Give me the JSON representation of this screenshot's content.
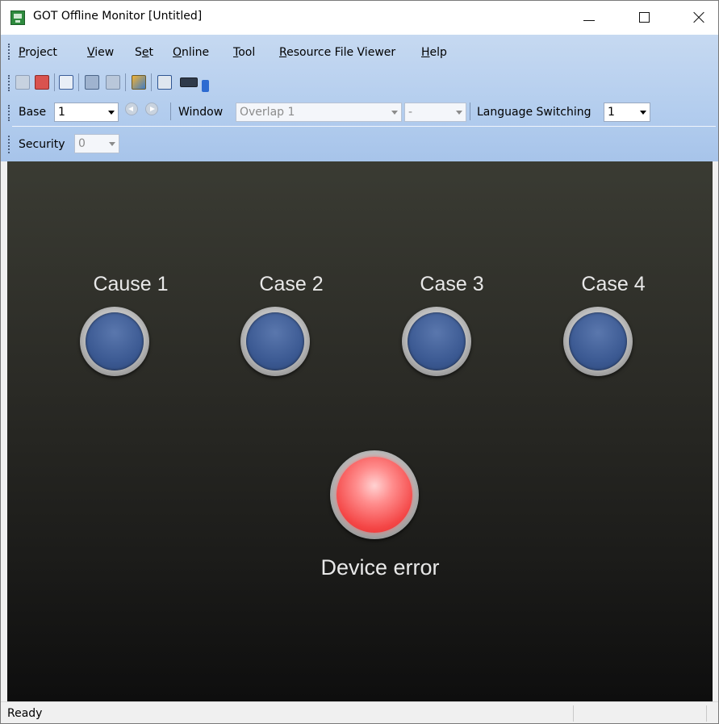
{
  "window": {
    "title": "GOT Offline Monitor  [Untitled]",
    "caption_buttons": [
      "minimize",
      "maximize",
      "close"
    ]
  },
  "menu": {
    "items": [
      {
        "pre": "",
        "u": "P",
        "post": "roject"
      },
      {
        "pre": "",
        "u": "V",
        "post": "iew"
      },
      {
        "pre": "S",
        "u": "e",
        "post": "t"
      },
      {
        "pre": "",
        "u": "O",
        "post": "nline"
      },
      {
        "pre": "",
        "u": "T",
        "post": "ool"
      },
      {
        "pre": "",
        "u": "R",
        "post": "esource File Viewer"
      },
      {
        "pre": "",
        "u": "H",
        "post": "elp"
      }
    ]
  },
  "toolbar1": {
    "icons": [
      "search-screen-icon",
      "search-screen-red-icon",
      "device-search-icon",
      "monitor-config-icon",
      "monitor-config-2-icon",
      "resource-icon",
      "screen-search-icon",
      "keyboard-icon",
      "toolbar-options-icon"
    ]
  },
  "toolbar2": {
    "base_label": "Base",
    "base_value": "1",
    "window_label": "Window",
    "window_value": "Overlap 1",
    "window_sub_value": "-",
    "language_label": "Language Switching",
    "language_value": "1"
  },
  "toolbar3": {
    "security_label": "Security",
    "security_value": "0"
  },
  "screen": {
    "lamps": [
      {
        "label": "Cause 1",
        "state": "off"
      },
      {
        "label": "Case 2",
        "state": "off"
      },
      {
        "label": "Case 3",
        "state": "off"
      },
      {
        "label": "Case 4",
        "state": "off"
      }
    ],
    "alarm": {
      "label": "Device error",
      "state": "on",
      "color": "#f44646"
    },
    "lamp_off_color": "#3c5a93"
  },
  "status": {
    "text": "Ready"
  }
}
